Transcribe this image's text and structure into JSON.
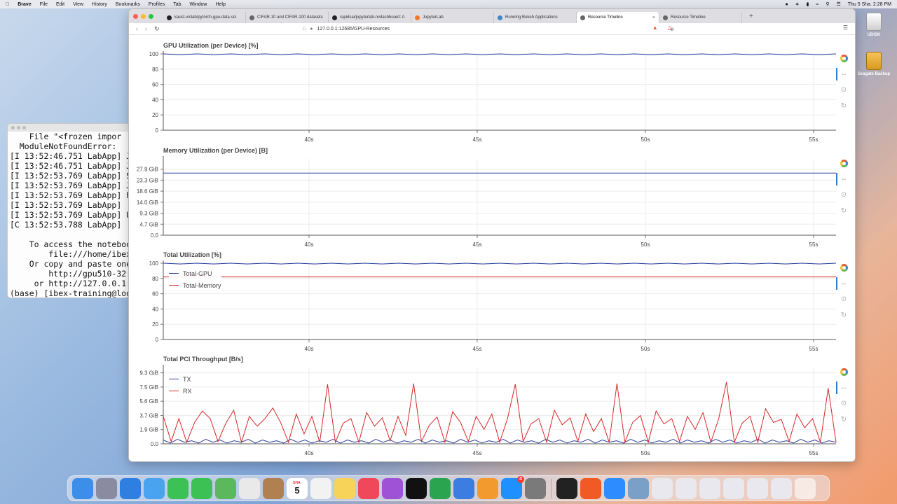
{
  "menubar": {
    "app": "Brave",
    "items": [
      "File",
      "Edit",
      "View",
      "History",
      "Bookmarks",
      "Profiles",
      "Tab",
      "Window",
      "Help"
    ],
    "clock": "Thu 5 Sha.  2:28 PM"
  },
  "desktop": {
    "icons": [
      {
        "label": "UDISK",
        "icon": "drive-icon"
      },
      {
        "label": "Seagate Backup",
        "icon": "external-drive-icon"
      }
    ]
  },
  "terminal": {
    "lines": [
      "    File \"<frozen impor",
      "  ModuleNotFoundError:",
      "[I 13:52:46.751 LabApp] J",
      "[I 13:52:46.751 LabApp] J",
      "[I 13:52:53.769 LabApp] S",
      "[I 13:52:53.769 LabApp] J",
      "[I 13:52:53.769 LabApp] h",
      "[I 13:52:53.769 LabApp]",
      "[I 13:52:53.769 LabApp] U",
      "[C 13:52:53.788 LabApp]",
      "",
      "    To access the noteboo",
      "        file:///home/ibex",
      "    Or copy and paste one",
      "        http://gpu510-32:",
      "     or http://127.0.0.1:",
      "(base) [ibex-training@log"
    ]
  },
  "browser": {
    "tabs": [
      {
        "title": "kaust-vislab/pytorch-gpu-data-sci",
        "icon": "github-icon",
        "active": false
      },
      {
        "title": "CIFAR-10 and CIFAR-100 datasets",
        "icon": "globe-icon",
        "active": false
      },
      {
        "title": "rapidsai/jupyterlab-nvdashboard: A",
        "icon": "github-icon",
        "active": false
      },
      {
        "title": "JupyterLab",
        "icon": "jupyter-icon",
        "active": false
      },
      {
        "title": "Running Bokeh Applications",
        "icon": "bokeh-icon",
        "active": false
      },
      {
        "title": "Resource Timeline",
        "icon": "globe-icon",
        "active": true
      },
      {
        "title": "Resource Timeline",
        "icon": "globe-icon",
        "active": false
      }
    ],
    "new_tab": "+",
    "url": "127.0.0.1:12685/GPU-Resources"
  },
  "chart_data": [
    {
      "type": "line",
      "title": "GPU Utilization (per Device) [%]",
      "xlabel": "",
      "ylabel": "",
      "x_ticks": [
        "40s",
        "45s",
        "50s",
        "55s"
      ],
      "y_ticks": [
        "0",
        "20",
        "40",
        "60",
        "80",
        "100"
      ],
      "ylim": [
        0,
        100
      ],
      "series": [
        {
          "color": "#2b3fa0",
          "values": [
            100,
            99,
            100,
            99,
            100,
            99,
            100,
            99,
            100,
            99,
            100,
            99,
            100,
            99,
            100,
            99,
            100,
            99,
            100,
            99,
            100,
            99,
            100,
            99,
            100,
            99,
            100,
            99,
            100,
            99,
            100,
            99,
            100,
            99,
            100,
            99,
            100,
            99,
            100,
            99,
            100
          ]
        }
      ]
    },
    {
      "type": "line",
      "title": "Memory Utilization (per Device) [B]",
      "xlabel": "",
      "ylabel": "",
      "x_ticks": [
        "40s",
        "45s",
        "50s",
        "55s"
      ],
      "y_ticks": [
        "0.0",
        "4.7 GiB",
        "9.3 GiB",
        "14.0 GiB",
        "18.6 GiB",
        "23.3 GiB",
        "27.9 GiB"
      ],
      "ylim": [
        0,
        32.3
      ],
      "series": [
        {
          "color": "#2b3fa0",
          "values": [
            26.3,
            26.3,
            26.3,
            26.3,
            26.3,
            26.3,
            26.3,
            26.3,
            26.3,
            26.3,
            26.3,
            26.3,
            26.3,
            26.3,
            26.3,
            26.3,
            26.3,
            26.3,
            26.3,
            26.3,
            26.3
          ]
        }
      ]
    },
    {
      "type": "line",
      "title": "Total Utilization [%]",
      "xlabel": "",
      "ylabel": "",
      "x_ticks": [
        "40s",
        "45s",
        "50s",
        "55s"
      ],
      "y_ticks": [
        "0",
        "20",
        "40",
        "60",
        "80",
        "100"
      ],
      "ylim": [
        0,
        100
      ],
      "legend": "top-left",
      "series": [
        {
          "name": "Total-GPU",
          "color": "#2b3fa0",
          "values": [
            100,
            99,
            100,
            99,
            100,
            99,
            100,
            99,
            100,
            99,
            100,
            99,
            100,
            99,
            100,
            99,
            100,
            99,
            100,
            99,
            100,
            99,
            100,
            99,
            100,
            99,
            100,
            99,
            100,
            99,
            100,
            99,
            100,
            99,
            100,
            99,
            100,
            99,
            100,
            99,
            100
          ]
        },
        {
          "name": "Total-Memory",
          "color": "#d62728",
          "values": [
            82,
            82,
            82,
            82,
            82,
            82,
            82,
            82,
            82,
            82,
            82,
            82,
            82,
            82,
            82,
            82,
            82,
            82,
            82,
            82,
            82
          ]
        }
      ]
    },
    {
      "type": "line",
      "title": "Total PCI Throughput [B/s]",
      "xlabel": "",
      "ylabel": "",
      "x_ticks": [
        "40s",
        "45s",
        "50s",
        "55s"
      ],
      "y_ticks": [
        "0.0",
        "1.9 GiB",
        "3.7 GiB",
        "5.6 GiB",
        "7.5 GiB",
        "9.3 GiB"
      ],
      "ylim": [
        0,
        10
      ],
      "legend": "top-left",
      "series": [
        {
          "name": "TX",
          "color": "#2b3fa0",
          "values": [
            0.5,
            0.1,
            0.6,
            0.2,
            0.4,
            0.1,
            0.6,
            0.2,
            0.5,
            0.1,
            0.4,
            0.2,
            0.6,
            0.1,
            0.5,
            0.2,
            0.4,
            0.1,
            0.6,
            0.2,
            0.5,
            0.1,
            0.4,
            0.2,
            0.6,
            0.1,
            0.5,
            0.2,
            0.4,
            0.1,
            0.6,
            0.2,
            0.5,
            0.1,
            0.4,
            0.2,
            0.6,
            0.1,
            0.5,
            0.2,
            0.4,
            0.1,
            0.6,
            0.2,
            0.5,
            0.1,
            0.4,
            0.2,
            0.6,
            0.1,
            0.5,
            0.2,
            0.4,
            0.1,
            0.6,
            0.2,
            0.5,
            0.1,
            0.4,
            0.2,
            0.6,
            0.1,
            0.5,
            0.2,
            0.4,
            0.1,
            0.6,
            0.2,
            0.5,
            0.1,
            0.4,
            0.2,
            0.6,
            0.1,
            0.5,
            0.2,
            0.4,
            0.1,
            0.6,
            0.2,
            0.5,
            0.1,
            0.4,
            0.2,
            0.6,
            0.1,
            0.5,
            0.2,
            0.4,
            0.1,
            0.6,
            0.2,
            0.5,
            0.1,
            0.4,
            0.2
          ]
        },
        {
          "name": "RX",
          "color": "#d62728",
          "values": [
            3.6,
            0.3,
            3.3,
            0.2,
            2.8,
            4.3,
            3.3,
            0.3,
            2.7,
            4.4,
            0.2,
            3.6,
            2.3,
            3.3,
            4.7,
            2.8,
            0.2,
            3.9,
            1.3,
            3.6,
            0.2,
            7.8,
            0.2,
            2.7,
            3.3,
            0.2,
            4.1,
            2.3,
            3.4,
            0.4,
            3.6,
            1.1,
            7.9,
            0.3,
            2.4,
            3.5,
            0.2,
            4.2,
            2.8,
            0.3,
            3.6,
            1.9,
            3.9,
            0.2,
            3.3,
            7.8,
            0.3,
            2.6,
            3.3,
            0.2,
            4.4,
            2.5,
            3.4,
            0.3,
            3.9,
            1.6,
            3.3,
            0.2,
            7.9,
            0.2,
            2.8,
            3.7,
            0.2,
            4.3,
            2.6,
            3.3,
            0.3,
            3.6,
            1.9,
            4.1,
            0.2,
            3.3,
            8.1,
            0.2,
            2.7,
            3.6,
            0.2,
            4.6,
            2.8,
            3.2,
            0.3,
            3.9,
            2.1,
            3.3,
            0.2,
            7.3,
            0.2
          ]
        }
      ]
    }
  ],
  "toolbar_tools": [
    "bokeh-logo-icon",
    "pan-icon",
    "wheel-zoom-icon",
    "reset-icon"
  ],
  "dock": {
    "apps": [
      "Finder",
      "Launchpad",
      "Safari",
      "Mail",
      "FaceTime",
      "Messages",
      "Maps",
      "Photos",
      "Contacts",
      "Calendar",
      "Reminders",
      "Notes",
      "Music",
      "Podcasts",
      "TV",
      "Numbers",
      "Keynote",
      "Pages",
      "App Store",
      "System Preferences",
      "Terminal",
      "Brave",
      "Zoom",
      "QuickTime"
    ],
    "calendar_month": "SHA.",
    "calendar_day": "5",
    "appstore_badge": "4"
  }
}
